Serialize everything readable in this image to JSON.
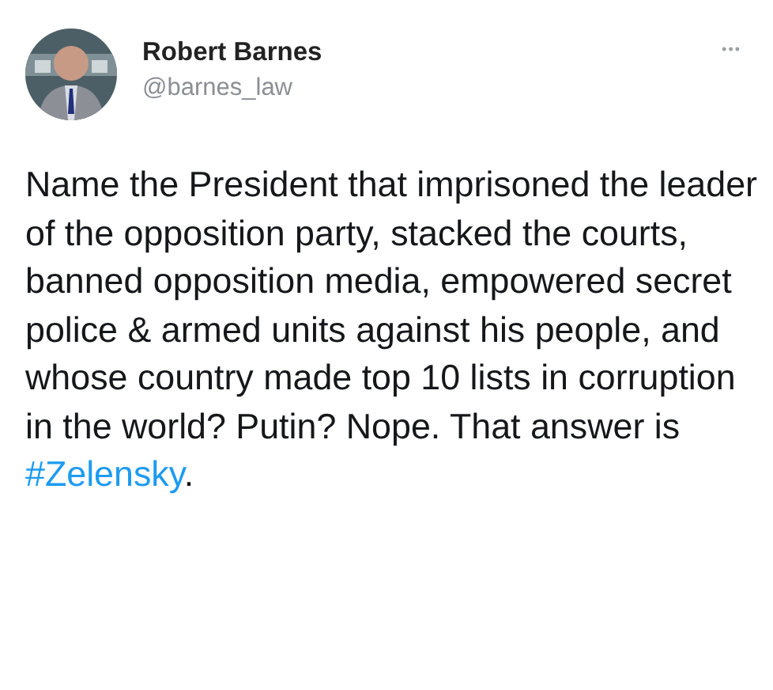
{
  "author": {
    "name": "Robert Barnes",
    "handle": "@barnes_law"
  },
  "more_menu": "•••",
  "tweet": {
    "text": "Name the President that imprisoned the leader of the opposition party, stacked the courts, banned opposition media, empowered secret police & armed units against his people, and whose country made top 10 lists in corruption in the world? Putin? Nope. That answer is ",
    "hashtag": "#Zelensky",
    "trailing": "."
  }
}
